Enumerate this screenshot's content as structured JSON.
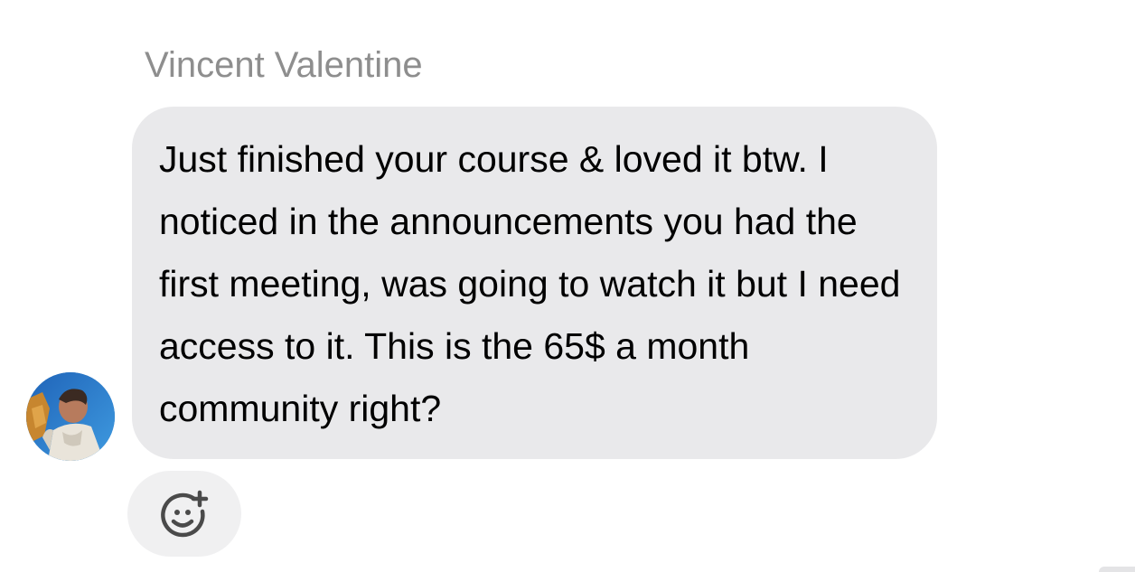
{
  "conversation": {
    "sender_name": "Vincent Valentine",
    "message_text": "Just finished your course & loved it btw. I noticed in the announcements you had the first meeting, was going to watch it but I need access to it. This is the 65$ a month community right?",
    "bubble_color": "#e9e9eb",
    "name_color": "#8e8e8e"
  },
  "avatar": {
    "icon": "profile-photo"
  },
  "reaction": {
    "icon": "add-reaction-smiley-icon"
  }
}
